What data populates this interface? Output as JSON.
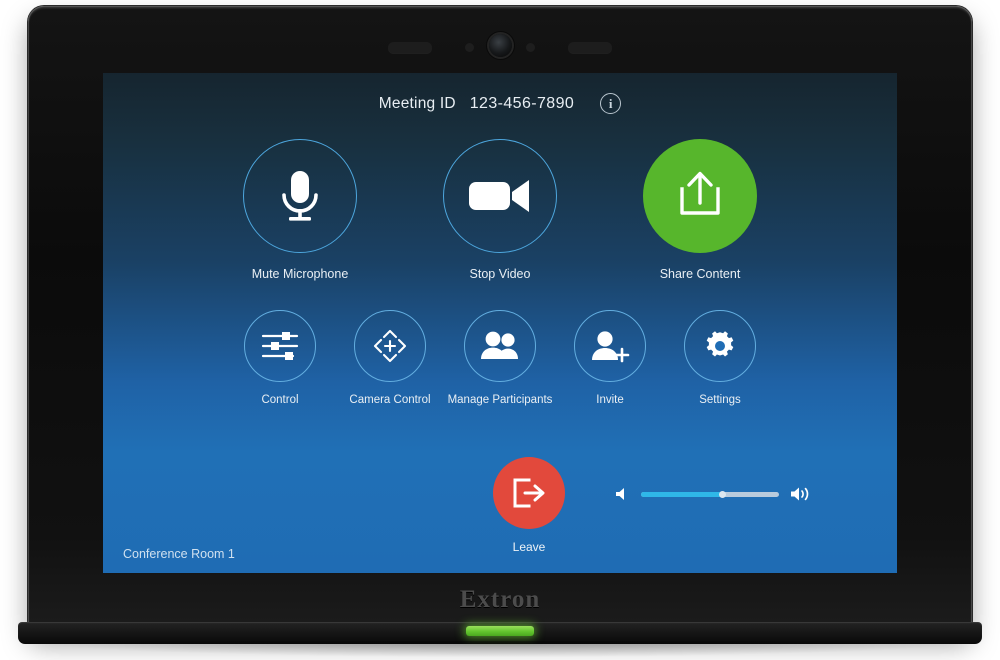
{
  "device": {
    "brand": "Extron",
    "status_led_color": "#62c52e",
    "camera_icon": "camera-lens",
    "bezel_elements": [
      "speaker-slot-left",
      "sensor-left",
      "camera-lens",
      "sensor-right",
      "speaker-slot-right"
    ]
  },
  "screen": {
    "background_top_color": "#16252f",
    "background_bottom_color": "#1f6cb4",
    "accent_ring_color": "#4da6dd",
    "header": {
      "meeting_id_label": "Meeting ID",
      "meeting_id_value": "123-456-7890",
      "info_icon": "info-icon",
      "info_glyph": "i"
    },
    "primary_actions": [
      {
        "label": "Mute Microphone",
        "icon": "microphone-icon",
        "style": "outline"
      },
      {
        "label": "Stop Video",
        "icon": "video-camera-icon",
        "style": "outline"
      },
      {
        "label": "Share Content",
        "icon": "share-upload-icon",
        "style": "filled",
        "fill_color": "#57b62c"
      }
    ],
    "secondary_actions": [
      {
        "label": "Control",
        "icon": "sliders-icon"
      },
      {
        "label": "Camera Control",
        "icon": "dpad-arrows-icon"
      },
      {
        "label": "Manage Participants",
        "icon": "two-people-icon"
      },
      {
        "label": "Invite",
        "icon": "person-add-icon"
      },
      {
        "label": "Settings",
        "icon": "gear-icon"
      }
    ],
    "leave": {
      "label": "Leave",
      "icon": "exit-arrow-icon",
      "color": "#e2493c"
    },
    "volume": {
      "level_percent": 60,
      "fill_color": "#2fb7e8",
      "track_color": "#b9cbdd",
      "icon_low": "speaker-low-icon",
      "icon_high": "speaker-high-icon"
    },
    "room_name": "Conference Room 1"
  }
}
